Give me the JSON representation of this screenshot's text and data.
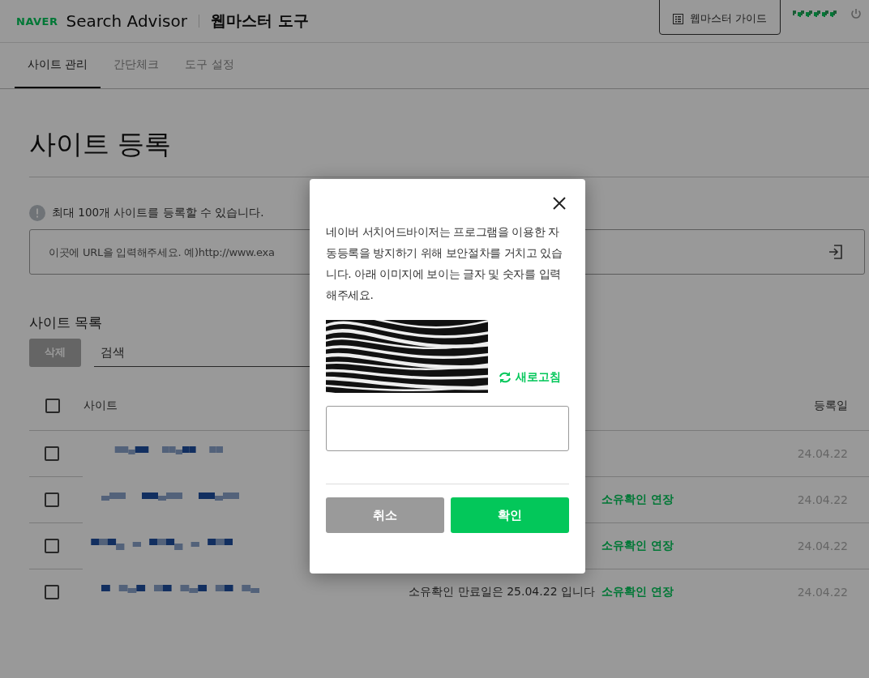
{
  "header": {
    "logo": "NAVER",
    "product": "Search Advisor",
    "section": "웹마스터 도구",
    "guide_button": "웹마스터 가이드"
  },
  "tabs": [
    {
      "label": "사이트 관리",
      "selected": true
    },
    {
      "label": "간단체크",
      "selected": false
    },
    {
      "label": "도구 설정",
      "selected": false
    }
  ],
  "page": {
    "title": "사이트 등록",
    "notice": "최대 100개 사이트를 등록할 수 있습니다.",
    "url_field": {
      "placeholder": "이곳에 URL을 입력해주세요. 예)http://www.exa"
    },
    "list_title": "사이트 목록",
    "delete_button": {
      "label": "삭제",
      "disabled": true
    },
    "search": {
      "placeholder": "검색"
    },
    "table": {
      "all_checked": false,
      "columns": [
        "사이트",
        "등록일"
      ],
      "rows": [
        {
          "checked": false,
          "date": "24.04.22"
        },
        {
          "checked": false,
          "link": "소유확인 연장",
          "date": "24.04.22"
        },
        {
          "checked": false,
          "link": "소유확인 연장",
          "date": "24.04.22"
        },
        {
          "checked": false,
          "status": "소유확인 만료일은 25.04.22 입니다",
          "link": "소유확인 연장",
          "date": "24.04.22"
        }
      ]
    }
  },
  "modal": {
    "message": "네이버 서치어드바이저는 프로그램을 이용한 자동등록을 방지하기 위해 보안절차를 거치고 있습니다. 아래 이미지에 보이는 글자 및 숫자를 입력해주세요.",
    "refresh_button": "새로고침",
    "buttons": [
      {
        "label": "취소",
        "kind": "cancel"
      },
      {
        "label": "확인",
        "kind": "confirm"
      }
    ]
  }
}
